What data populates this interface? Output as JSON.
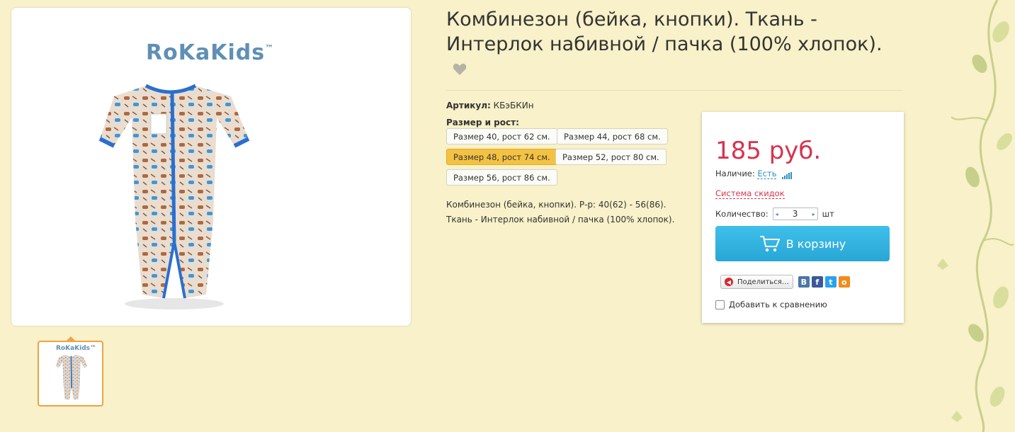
{
  "product": {
    "title": "Комбинезон (бейка, кнопки). Ткань - Интерлок набивной / пачка (100% хлопок).",
    "sku_label": "Артикул:",
    "sku_value": "КБэБКИн",
    "size_label": "Размер и рост:",
    "sizes": [
      {
        "label": "Размер 40, рост 62 см.",
        "selected": false
      },
      {
        "label": "Размер 44, рост 68 см.",
        "selected": false
      },
      {
        "label": "Размер 48, рост 74 см.",
        "selected": true
      },
      {
        "label": "Размер 52, рост 80 см.",
        "selected": false
      },
      {
        "label": "Размер 56, рост 86 см.",
        "selected": false
      }
    ],
    "description_line1": "Комбинезон (бейка, кнопки). Р-р: 40(62) - 56(86).",
    "description_line2": "Ткань - Интерлок набивной / пачка (100% хлопок)."
  },
  "gallery": {
    "brand": "RoKaKids",
    "trademark": "™",
    "thumb_brand": "RoKaKids™"
  },
  "buy": {
    "price": "185 руб.",
    "availability_label": "Наличие:",
    "availability_value": "Есть",
    "discount_link": "Система скидок",
    "quantity_label": "Количество:",
    "quantity_value": "3",
    "quantity_unit": "шт",
    "cart_button": "В корзину",
    "share_button": "Поделиться…",
    "compare_label": "Добавить к сравнению"
  },
  "colors": {
    "price": "#d7334f",
    "cart_button": "#2eb3e0",
    "selected_size": "#f4c242",
    "background": "#f8f1c9"
  },
  "icons": {
    "favorite": "heart-icon",
    "cart": "cart-icon",
    "signal": "signal-bars-icon",
    "social": [
      "vk-icon",
      "facebook-icon",
      "twitter-icon",
      "odnoklassniki-icon"
    ]
  }
}
